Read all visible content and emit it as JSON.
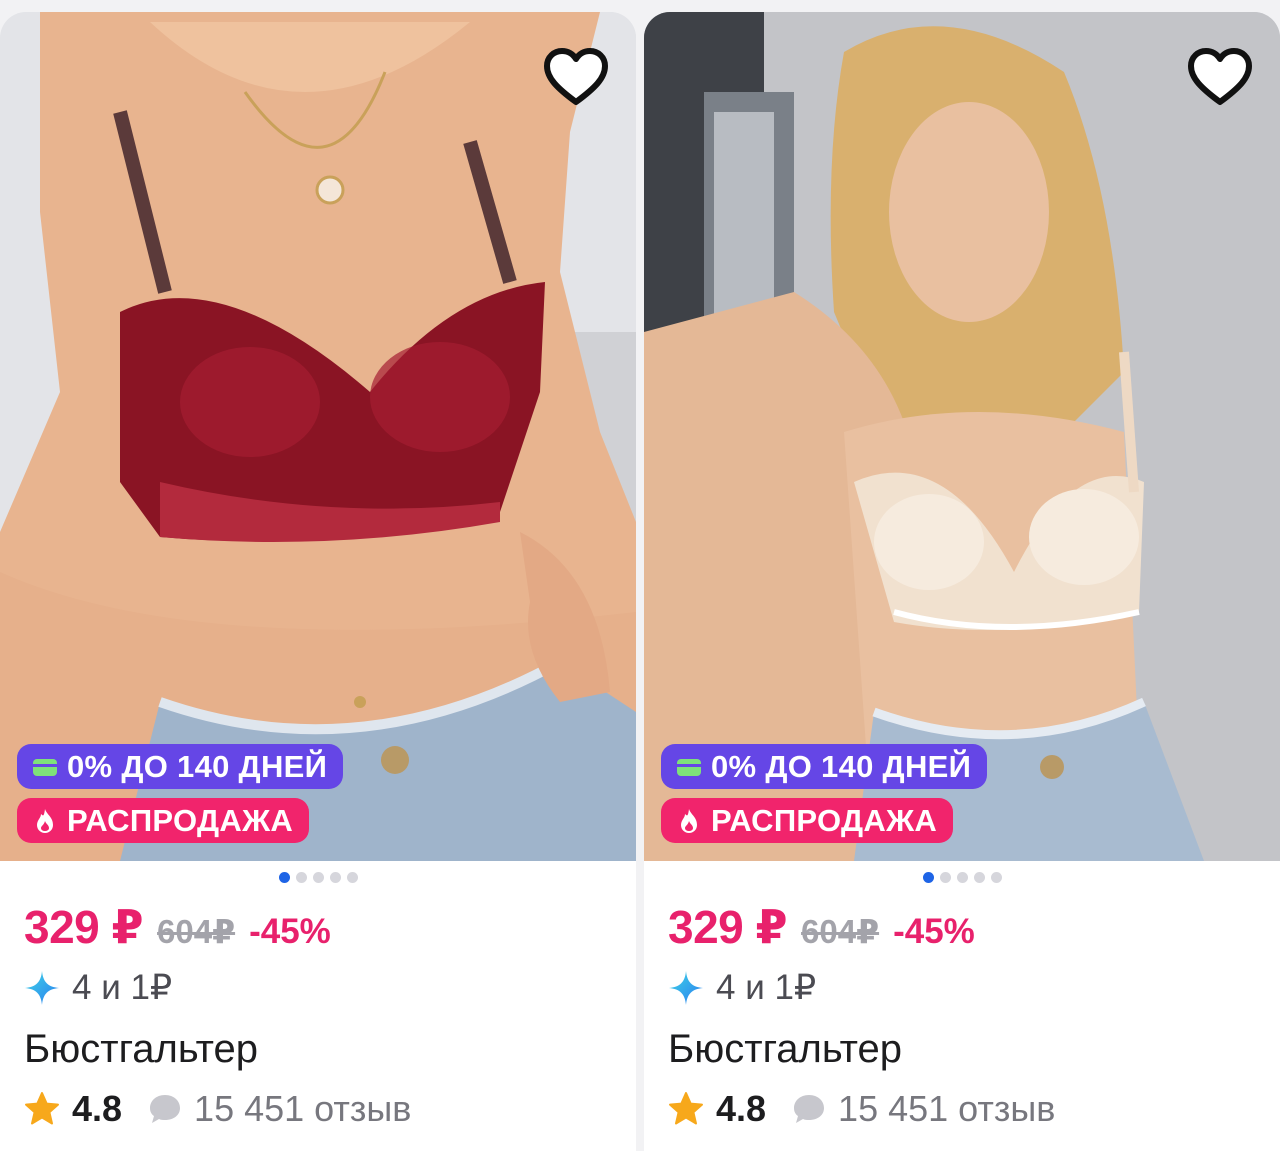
{
  "products": [
    {
      "image_alt": "red-lace-bra-photo",
      "badges": {
        "installment": "0% ДО 140 ДНЕЙ",
        "sale": "РАСПРОДАЖА"
      },
      "carousel": {
        "total": 5,
        "active": 1
      },
      "price": "329 ₽",
      "old_price": "604₽",
      "discount": "-45%",
      "bonus": "4 и 1₽",
      "title": "Бюстгальтер",
      "rating": "4.8",
      "reviews": "15 451 отзыв"
    },
    {
      "image_alt": "beige-lace-bra-photo",
      "badges": {
        "installment": "0% ДО 140 ДНЕЙ",
        "sale": "РАСПРОДАЖА"
      },
      "carousel": {
        "total": 5,
        "active": 1
      },
      "price": "329 ₽",
      "old_price": "604₽",
      "discount": "-45%",
      "bonus": "4 и 1₽",
      "title": "Бюстгальтер",
      "rating": "4.8",
      "reviews": "15 451 отзыв"
    }
  ],
  "colors": {
    "accent": "#e8216c",
    "installment": "#6546e6",
    "sale": "#f1246c",
    "dot_active": "#1e64e6",
    "star": "#f7a81b"
  },
  "icons": {
    "favorite": "heart-outline-icon",
    "installment": "card-icon",
    "sale": "fire-icon",
    "bonus": "sparkle-icon",
    "rating": "star-icon",
    "reviews": "comment-bubble-icon"
  }
}
